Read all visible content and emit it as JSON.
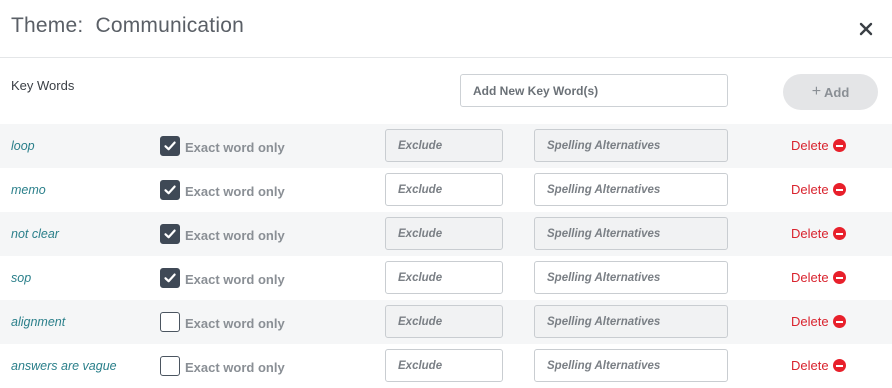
{
  "header": {
    "title": "Theme:  Communication",
    "close_icon": "close-icon"
  },
  "keywords": {
    "label": "Key Words",
    "add_placeholder": "Add New Key Word(s)",
    "add_button": "Add"
  },
  "rows": [
    {
      "word": "loop",
      "exact_checked": true
    },
    {
      "word": "memo",
      "exact_checked": true
    },
    {
      "word": "not clear",
      "exact_checked": true
    },
    {
      "word": "sop",
      "exact_checked": true
    },
    {
      "word": "alignment",
      "exact_checked": false
    },
    {
      "word": "answers are vague",
      "exact_checked": false
    }
  ],
  "row_labels": {
    "exact_label": "Exact word only",
    "exclude_placeholder": "Exclude",
    "spelling_placeholder": "Spelling Alternatives",
    "delete_label": "Delete"
  },
  "colors": {
    "accent_teal": "#2a7f8a",
    "delete_red": "#d9232e",
    "checkbox_dark": "#3f4956"
  }
}
